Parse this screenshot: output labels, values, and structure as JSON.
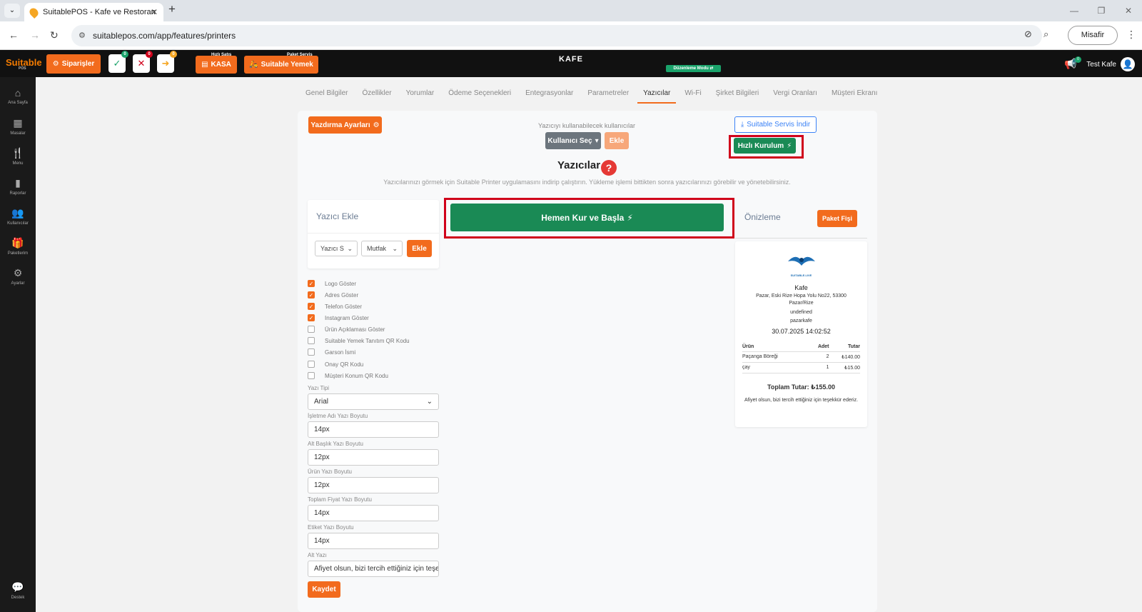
{
  "browser": {
    "tab_title": "SuitablePOS - Kafe ve Restoran",
    "url": "suitablepos.com/app/features/printers",
    "guest_label": "Misafir"
  },
  "header": {
    "logo": "Suitable",
    "logo_sub": "POS",
    "orders_label": "Siparişler",
    "badge_green": "0",
    "badge_red": "0",
    "badge_yellow": "0",
    "quick_sale_caption": "Hızlı Satış",
    "kasa_label": "KASA",
    "package_caption": "Paket Servis",
    "suitable_yemek_label": "Suitable Yemek",
    "venue_name": "KAFE",
    "edit_mode": "Düzenleme Modu",
    "notif_count": "0",
    "user_name": "Test Kafe"
  },
  "sidebar": {
    "items": [
      {
        "label": "Ana Sayfa",
        "icon": "home-icon"
      },
      {
        "label": "Masalar",
        "icon": "table-icon"
      },
      {
        "label": "Menu",
        "icon": "utensils-icon"
      },
      {
        "label": "Raporlar",
        "icon": "report-icon"
      },
      {
        "label": "Kullanıcılar",
        "icon": "users-icon"
      },
      {
        "label": "Paketlerim",
        "icon": "gift-icon"
      },
      {
        "label": "Ayarlar",
        "icon": "gears-icon"
      }
    ],
    "support": "Destek"
  },
  "tabs": [
    "Genel Bilgiler",
    "Özellikler",
    "Yorumlar",
    "Ödeme Seçenekleri",
    "Entegrasyonlar",
    "Parametreler",
    "Yazıcılar",
    "Wi-Fi",
    "Şirket Bilgileri",
    "Vergi Oranları",
    "Müşteri Ekranı"
  ],
  "printers": {
    "print_settings": "Yazdırma Ayarları",
    "users_caption": "Yazıcıyı kullanabilecek kullanıcılar",
    "select_user": "Kullanıcı Seç",
    "add": "Ekle",
    "download_service": "Suitable Servis İndir",
    "quick_setup": "Hızlı Kurulum",
    "title": "Yazıcılar",
    "help_text": "Yazıcılarınızı görmek için Suitable Printer uygulamasını indirip çalıştırın. Yükleme işlemi bittikten sonra yazıcılarınızı görebilir ve yönetebilirsiniz.",
    "setup_start": "Hemen Kur ve Başla"
  },
  "add_printer": {
    "title": "Yazıcı Ekle",
    "printer_select": "Yazıcı S",
    "category_select": "Mutfak",
    "add_button": "Ekle"
  },
  "options": [
    {
      "label": "Logo Göster",
      "checked": true
    },
    {
      "label": "Adres Göster",
      "checked": true
    },
    {
      "label": "Telefon Göster",
      "checked": true
    },
    {
      "label": "Instagram Göster",
      "checked": true
    },
    {
      "label": "Ürün Açıklaması Göster",
      "checked": false
    },
    {
      "label": "Suitable Yemek Tanıtım QR Kodu",
      "checked": false
    },
    {
      "label": "Garson İsmi",
      "checked": false
    },
    {
      "label": "Onay QR Kodu",
      "checked": false
    },
    {
      "label": "Müşteri Konum QR Kodu",
      "checked": false
    }
  ],
  "fields": {
    "font_label": "Yazı Tipi",
    "font_value": "Arial",
    "biz_label": "İşletme Adı Yazı Boyutu",
    "biz_value": "14px",
    "sub_label": "Alt Başlık Yazı Boyutu",
    "sub_value": "12px",
    "product_label": "Ürün Yazı Boyutu",
    "product_value": "12px",
    "total_label": "Toplam Fiyat Yazı Boyutu",
    "total_value": "14px",
    "tag_label": "Etiket Yazı Boyutu",
    "tag_value": "14px",
    "footer_label": "Alt Yazı",
    "footer_value": "Afiyet olsun, bizi tercih ettiğiniz için teşekkür ederiz.",
    "save": "Kaydet"
  },
  "preview": {
    "title": "Önizleme",
    "package_receipt": "Paket Fişi",
    "logo_text": "SUITABLE.LIVE",
    "name": "Kafe",
    "address": "Pazar, Eski Rize Hopa Yolu No22, 53300",
    "city": "Pazar/Rize",
    "phone": "undefined",
    "instagram": "pazarkafe",
    "datetime": "30.07.2025 14:02:52",
    "col_product": "Ürün",
    "col_qty": "Adet",
    "col_total": "Tutar",
    "rows": [
      {
        "name": "Paçanga Böreği",
        "qty": "2",
        "total": "₺140.00"
      },
      {
        "name": "çay",
        "qty": "1",
        "total": "₺15.00"
      }
    ],
    "grand_total": "Toplam Tutar: ₺155.00",
    "footer": "Afiyet olsun, bizi tercih ettiğiniz için teşekkür ederiz."
  }
}
